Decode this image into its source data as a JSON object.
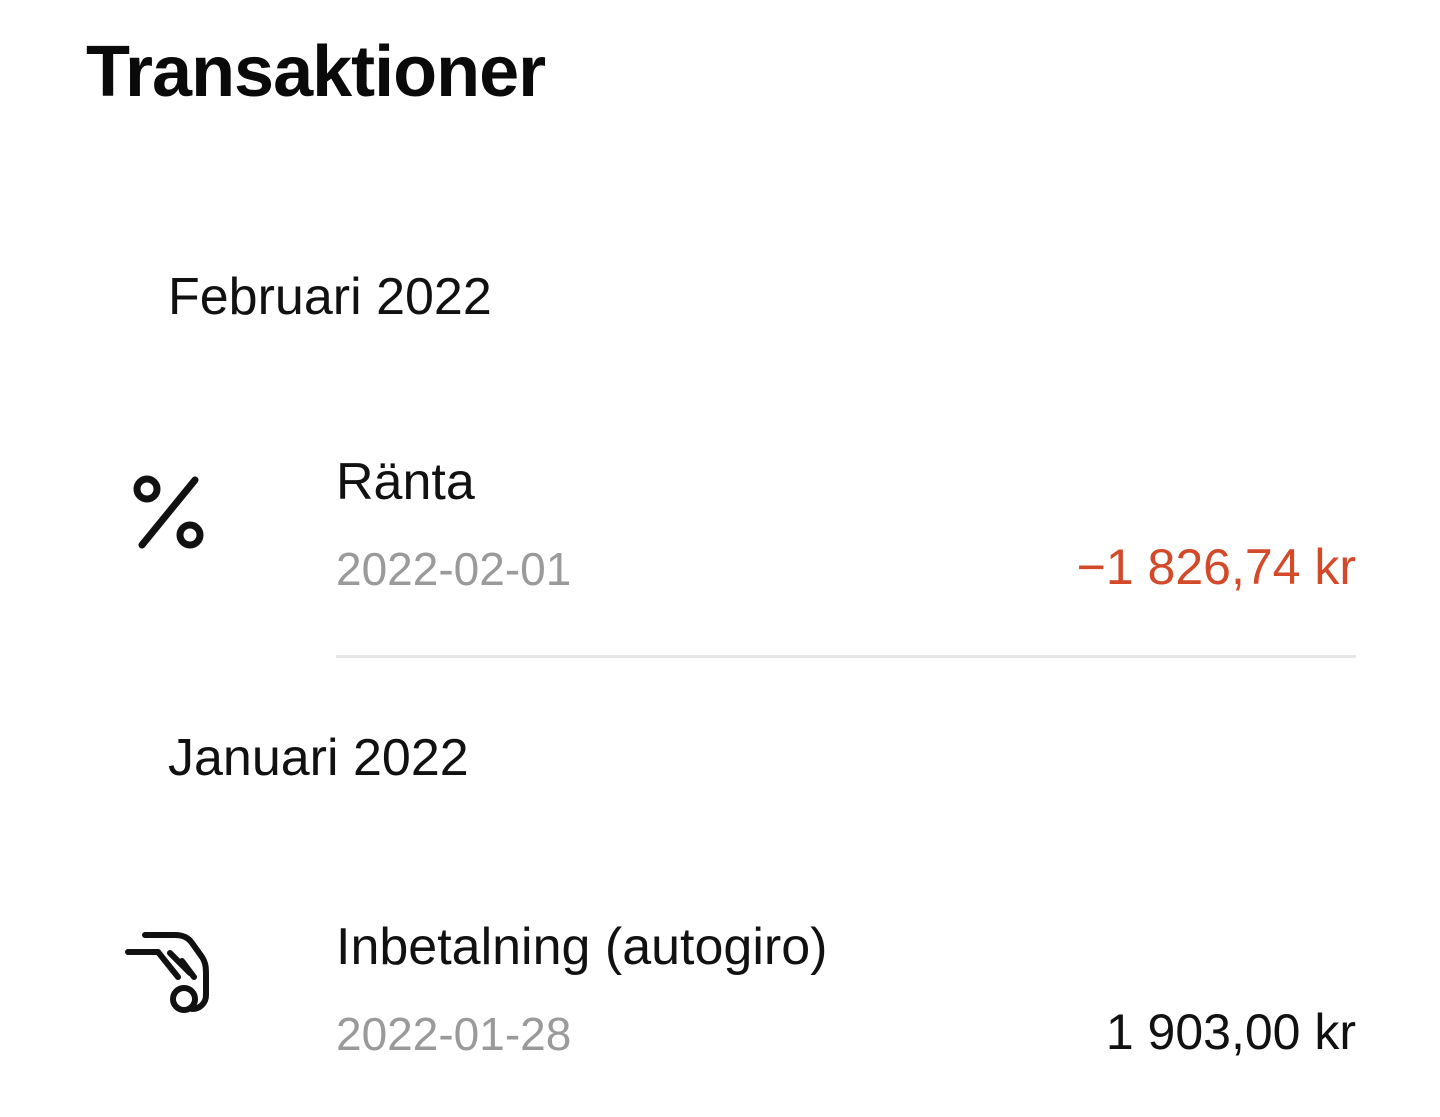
{
  "page": {
    "title": "Transaktioner"
  },
  "groups": [
    {
      "month": "Februari 2022",
      "transactions": [
        {
          "icon": "percent-icon",
          "title": "Ränta",
          "date": "2022-02-01",
          "amount": "−1 826,74 kr",
          "amount_color": "#d24a2a"
        }
      ]
    },
    {
      "month": "Januari 2022",
      "transactions": [
        {
          "icon": "hand-coin-icon",
          "title": "Inbetalning (autogiro)",
          "date": "2022-01-28",
          "amount": "1 903,00 kr",
          "amount_color": "#111111"
        }
      ]
    }
  ]
}
